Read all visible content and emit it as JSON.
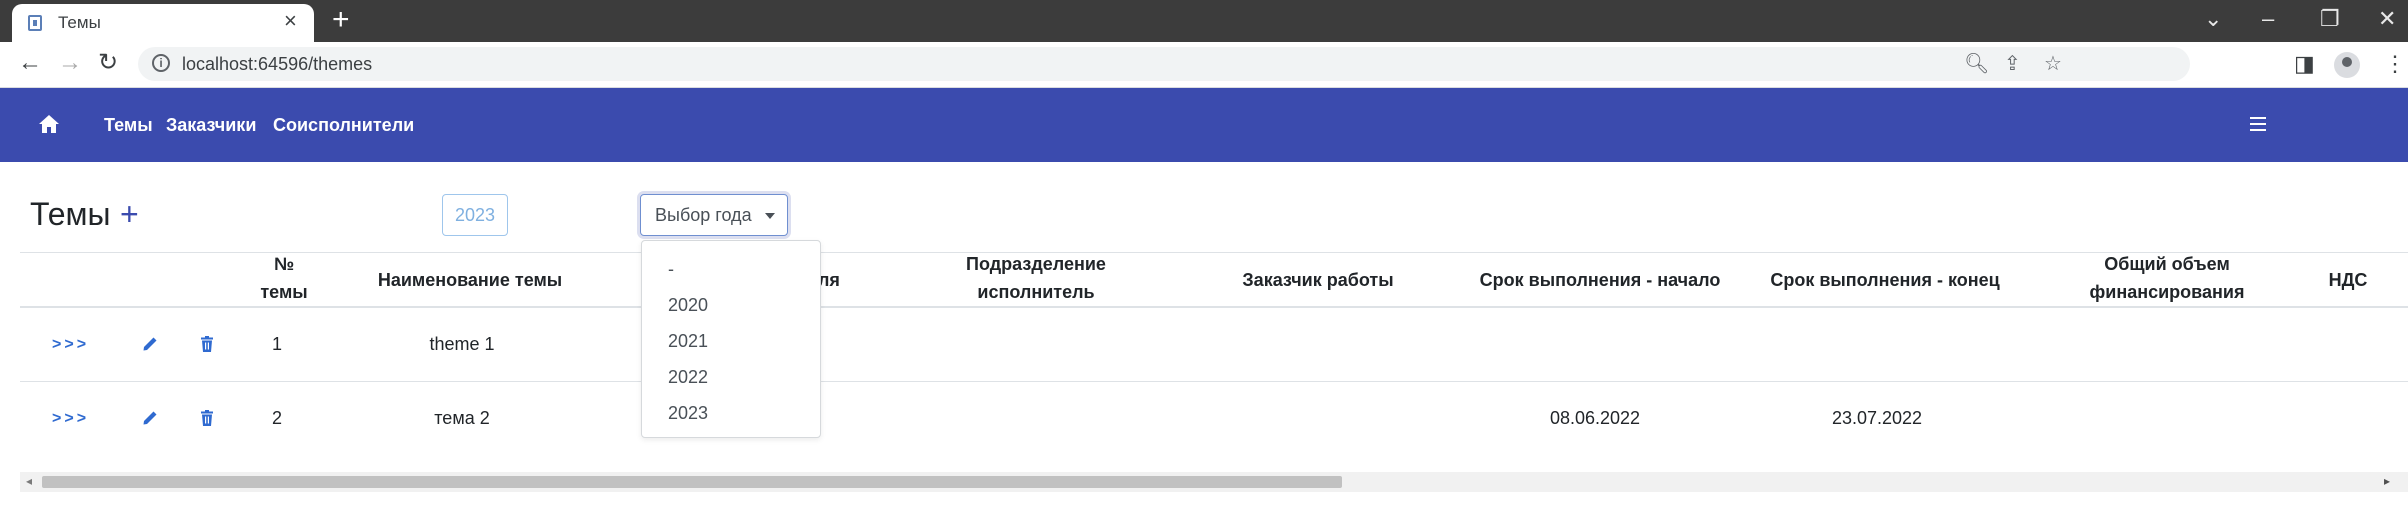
{
  "browser": {
    "tab_title": "Темы",
    "tab_close": "×",
    "new_tab": "+",
    "url": "localhost:64596/themes",
    "window_controls": {
      "chevron": "⌄",
      "minimize": "–",
      "restore": "❐",
      "close": "✕"
    },
    "nav": {
      "back": "←",
      "forward": "→",
      "reload": "↻"
    }
  },
  "navbar": {
    "brand_color": "#3b4bae",
    "links": [
      "Темы",
      "Заказчики",
      "Соисполнители"
    ]
  },
  "page": {
    "title": "Темы",
    "add_symbol": "+",
    "year_badge": "2023",
    "year_select_label": "Выбор года"
  },
  "table": {
    "headers": {
      "number_line1": "№",
      "number_line2": "темы",
      "name": "Наименование темы",
      "partial": "ля",
      "dept_line1": "Подразделение",
      "dept_line2": "исполнитель",
      "customer": "Заказчик работы",
      "start": "Срок выполнения - начало",
      "end": "Срок выполнения - конец",
      "funding_line1": "Общий объем",
      "funding_line2": "финансирования",
      "vat": "НДС"
    },
    "rows": [
      {
        "link": ">>>",
        "number": "1",
        "name": "theme 1",
        "start": "",
        "end": ""
      },
      {
        "link": ">>>",
        "number": "2",
        "name": "тема 2",
        "start": "08.06.2022",
        "end": "23.07.2022"
      }
    ]
  },
  "dropdown": {
    "items": [
      "-",
      "2020",
      "2021",
      "2022",
      "2023"
    ]
  }
}
